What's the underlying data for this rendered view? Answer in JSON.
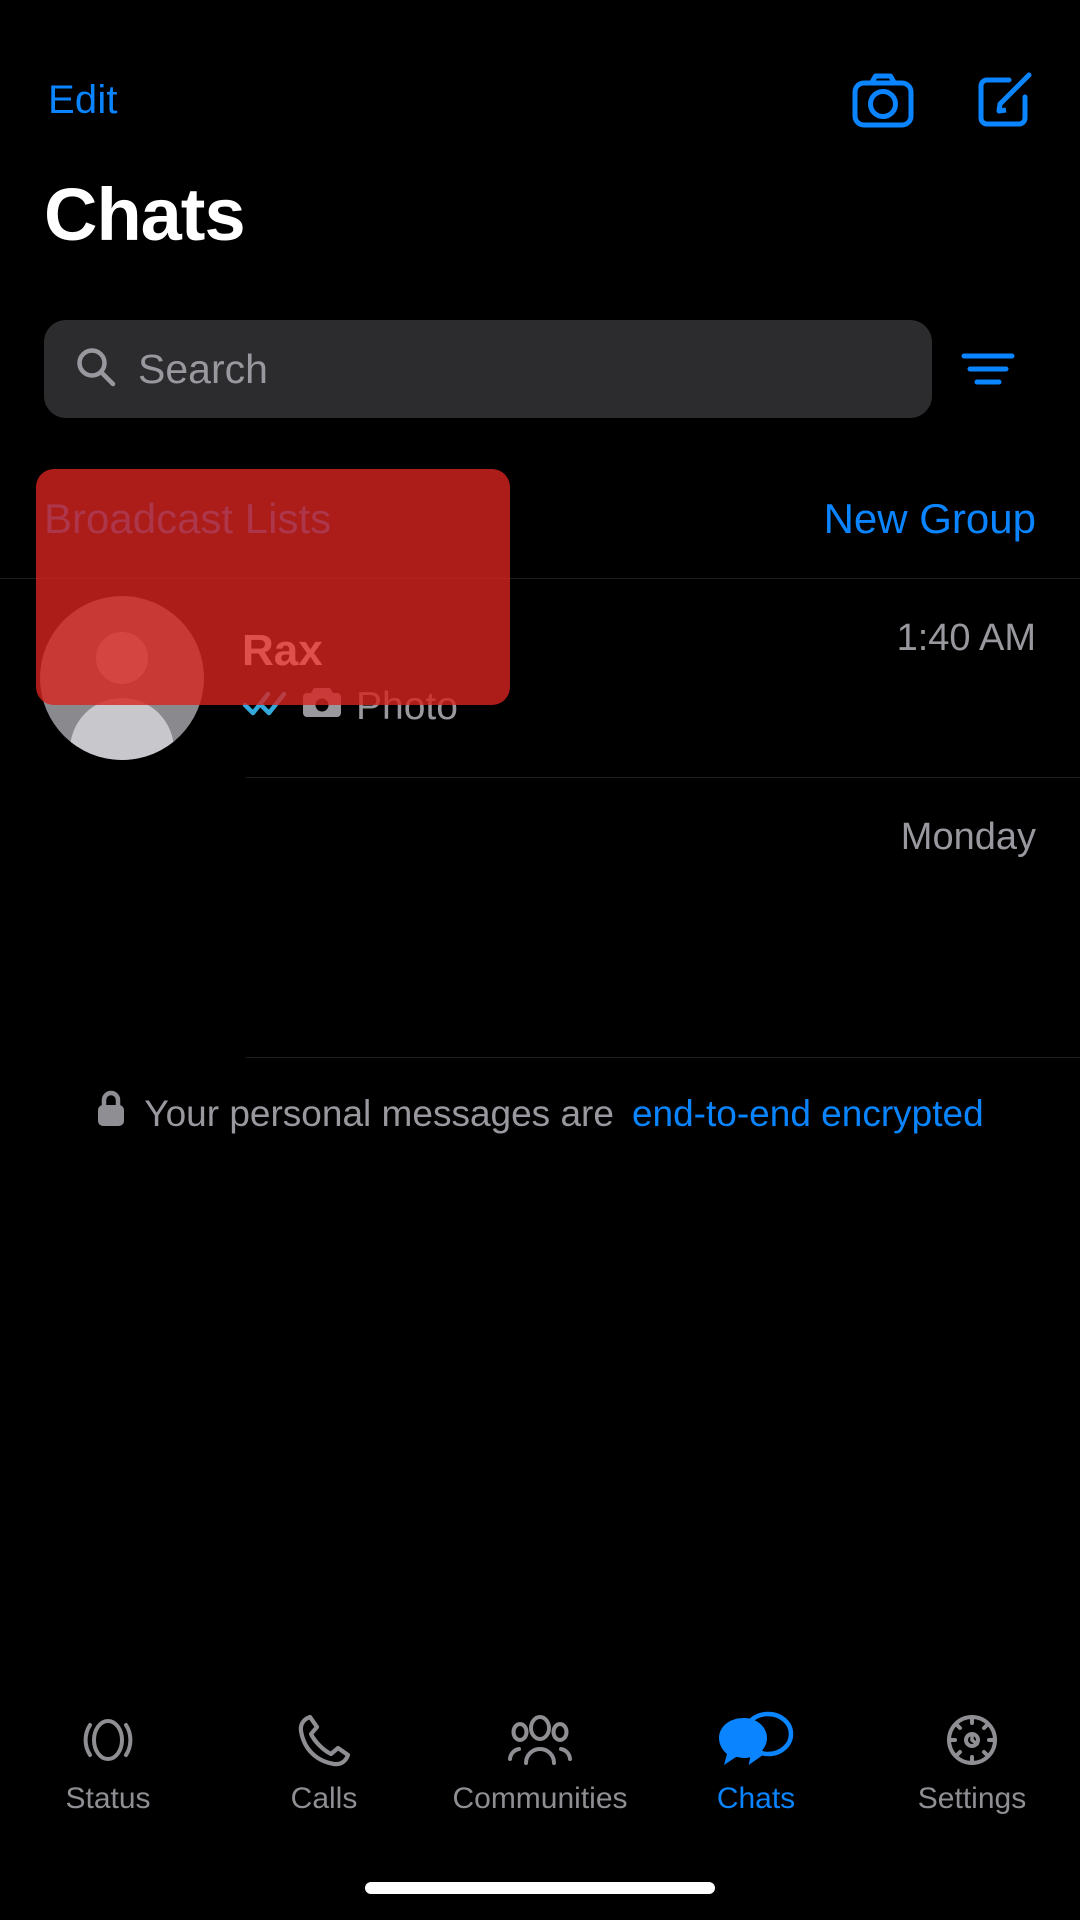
{
  "app": {
    "background": "#000000",
    "accent": "#0a84ff",
    "muted": "#98989e",
    "selection_color": "#d7231e"
  },
  "topbar": {
    "edit_label": "Edit",
    "camera_icon": "camera-icon",
    "compose_icon": "compose-icon"
  },
  "header": {
    "title": "Chats"
  },
  "search": {
    "placeholder": "Search",
    "value": "",
    "search_icon": "search-icon",
    "filter_icon": "filter-icon"
  },
  "links": {
    "broadcast_lists": "Broadcast Lists",
    "new_group": "New Group"
  },
  "chats": [
    {
      "name": "Rax",
      "status_icon": "double-check-icon",
      "media_icon": "camera-icon",
      "preview": "Photo",
      "time": "1:40 AM",
      "selected": true
    },
    {
      "name": "",
      "status_icon": "",
      "media_icon": "",
      "preview": "",
      "time": "Monday",
      "selected": false
    }
  ],
  "encryption": {
    "lock_icon": "lock-icon",
    "text": "Your personal messages are",
    "link_text": "end-to-end encrypted"
  },
  "tabbar": {
    "items": [
      {
        "label": "Status",
        "icon": "status-rings-icon",
        "active": false
      },
      {
        "label": "Calls",
        "icon": "phone-icon",
        "active": false
      },
      {
        "label": "Communities",
        "icon": "people-group-icon",
        "active": false
      },
      {
        "label": "Chats",
        "icon": "chat-bubbles-icon",
        "active": true
      },
      {
        "label": "Settings",
        "icon": "gear-icon",
        "active": false
      }
    ]
  },
  "home_indicator": "home-indicator"
}
